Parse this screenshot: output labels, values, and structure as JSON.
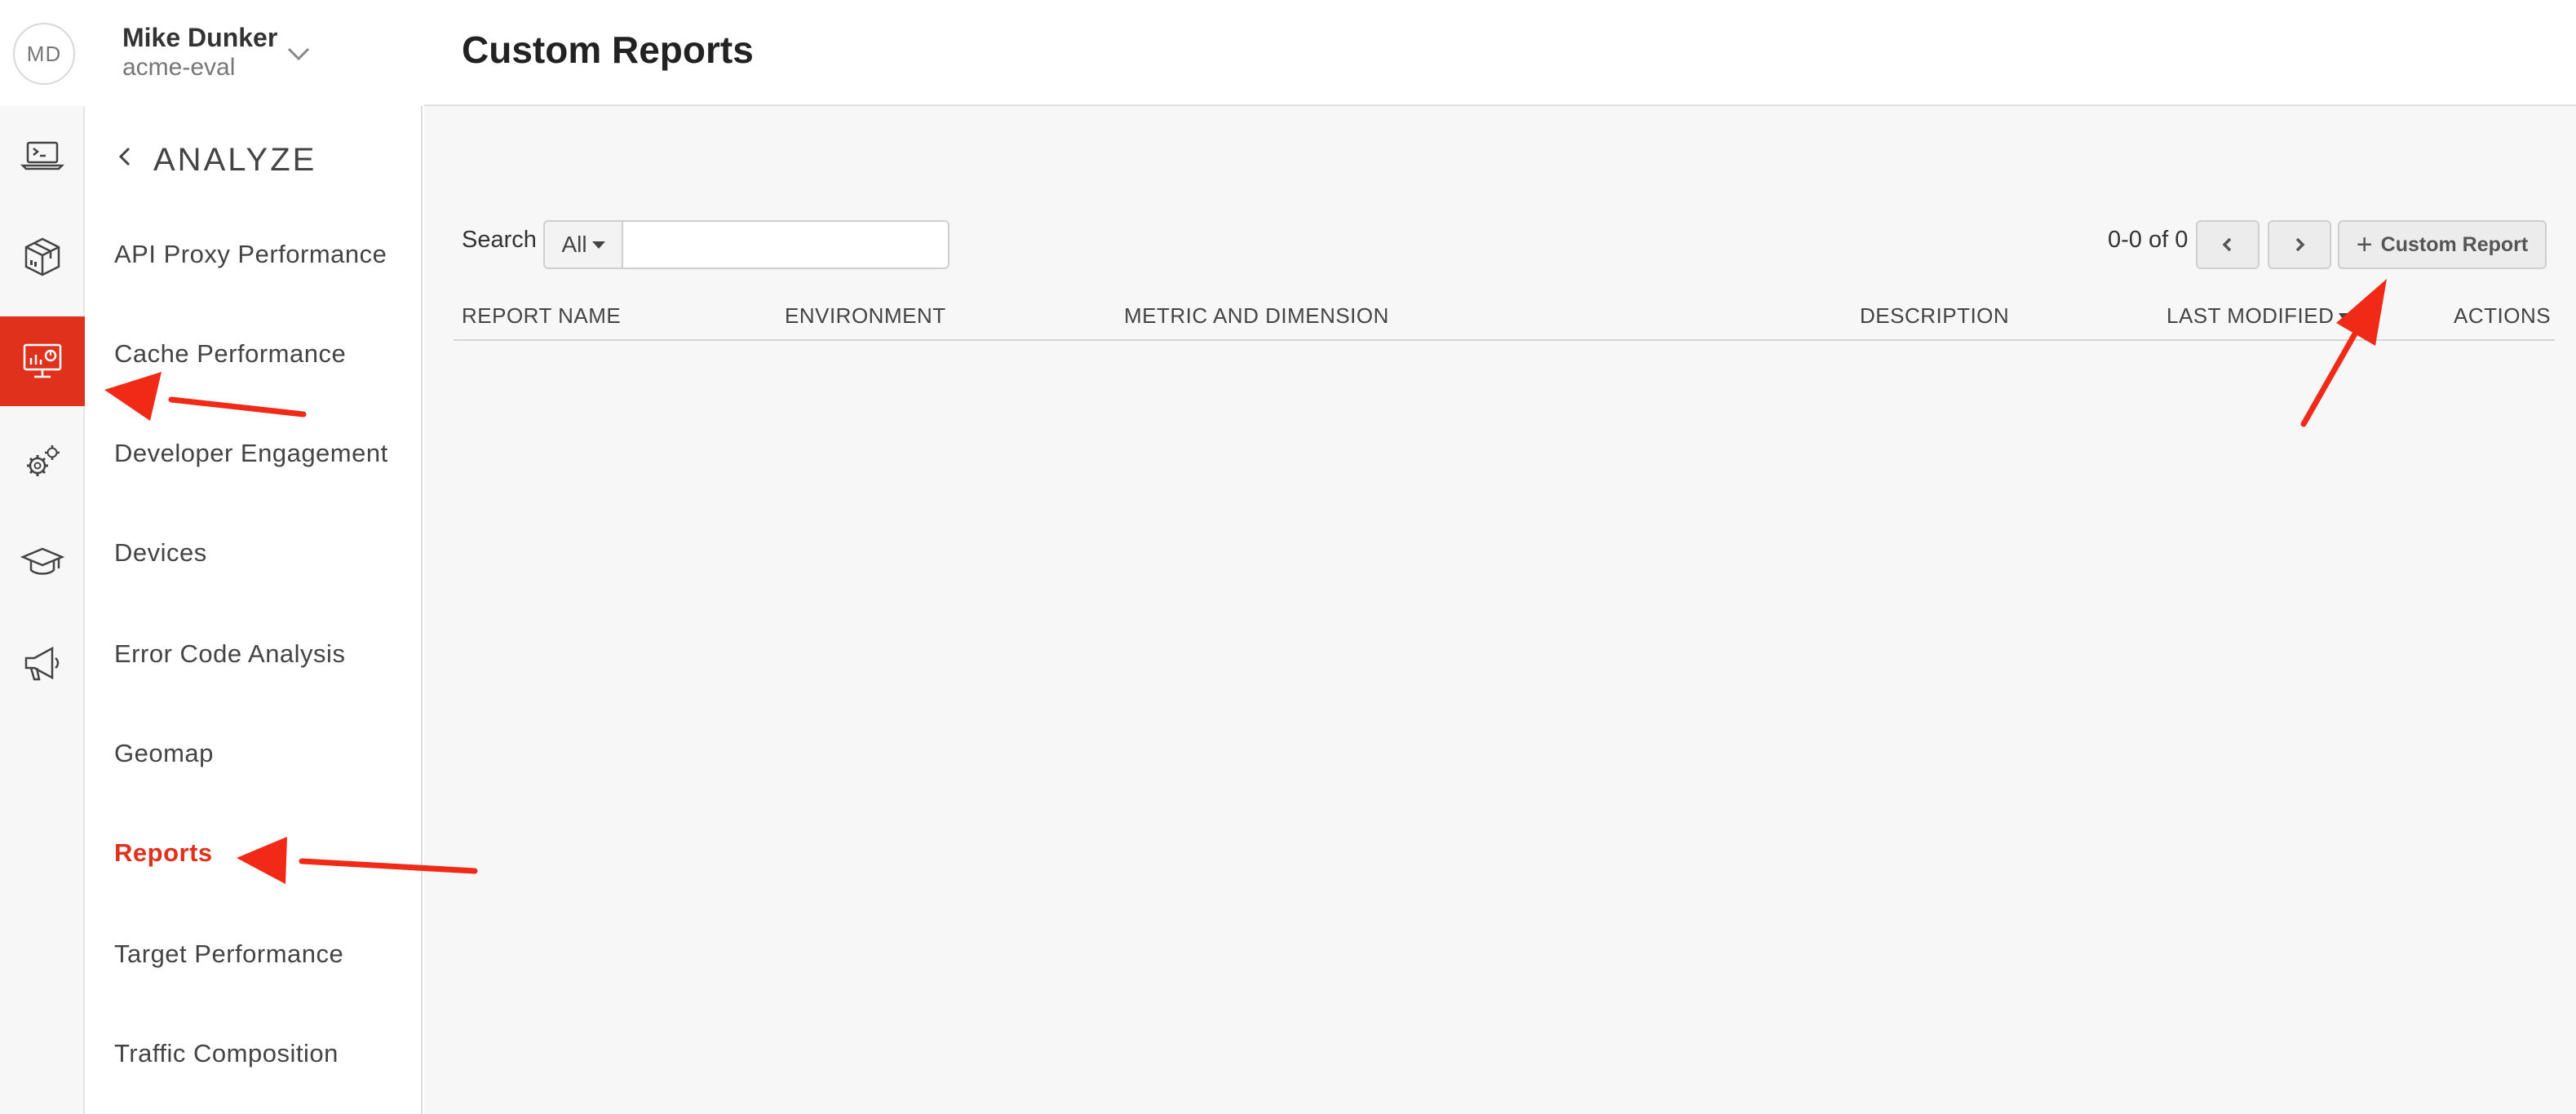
{
  "user": {
    "initials": "MD",
    "name": "Mike Dunker",
    "org": "acme-eval"
  },
  "icon_rail": {
    "items": [
      {
        "icon": "terminal-laptop-icon",
        "active": false
      },
      {
        "icon": "package-box-icon",
        "active": false
      },
      {
        "icon": "analytics-monitor-icon",
        "active": true
      },
      {
        "icon": "gears-icon",
        "active": false
      },
      {
        "icon": "graduation-cap-icon",
        "active": false
      },
      {
        "icon": "megaphone-icon",
        "active": false
      }
    ],
    "active_color": "#e0311d"
  },
  "sub_nav": {
    "section_title": "ANALYZE",
    "items": [
      {
        "label": "API Proxy Performance"
      },
      {
        "label": "Cache Performance"
      },
      {
        "label": "Developer Engagement"
      },
      {
        "label": "Devices"
      },
      {
        "label": "Error Code Analysis"
      },
      {
        "label": "Geomap"
      },
      {
        "label": "Reports",
        "active": true
      },
      {
        "label": "Target Performance"
      },
      {
        "label": "Traffic Composition"
      }
    ]
  },
  "page": {
    "title": "Custom Reports"
  },
  "toolbar": {
    "search_label": "Search",
    "filter_selected": "All",
    "search_value": "",
    "pagination": "0-0 of 0",
    "add_button_label": "Custom Report"
  },
  "table": {
    "columns": [
      {
        "label": "REPORT NAME"
      },
      {
        "label": "ENVIRONMENT"
      },
      {
        "label": "METRIC AND DIMENSION"
      },
      {
        "label": "DESCRIPTION"
      },
      {
        "label": "LAST MODIFIED",
        "sorted": "desc"
      },
      {
        "label": "ACTIONS"
      }
    ],
    "rows": []
  },
  "annotation_color": "#f02a17"
}
